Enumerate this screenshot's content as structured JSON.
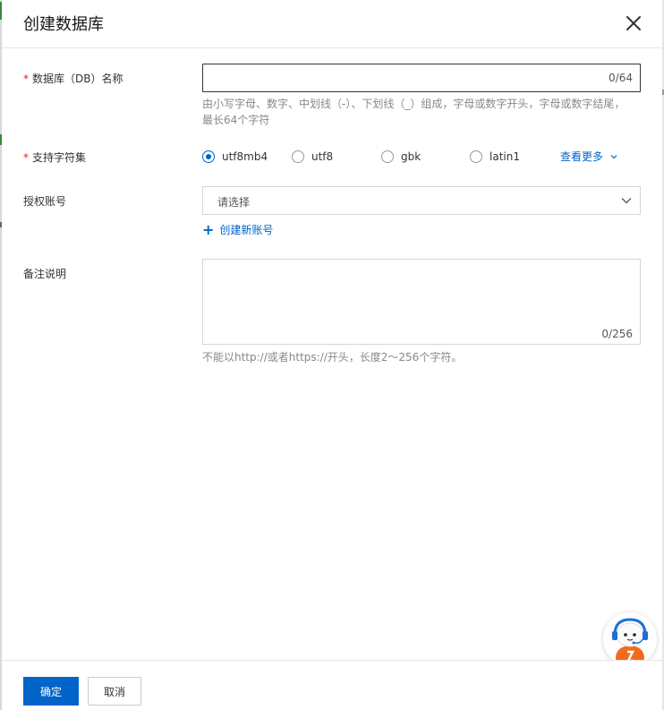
{
  "dialog": {
    "title": "创建数据库"
  },
  "form": {
    "db_name": {
      "required_mark": "*",
      "label": "数据库（DB）名称",
      "value": "",
      "counter": "0/64",
      "hint_line1": "由小写字母、数字、中划线（-）、下划线（_）组成，字母或数字开头，字母或数字结尾，",
      "hint_line2": "最长64个字符"
    },
    "charset": {
      "required_mark": "*",
      "label": "支持字符集",
      "options": [
        "utf8mb4",
        "utf8",
        "gbk",
        "latin1"
      ],
      "selected": "utf8mb4",
      "more_label": "查看更多"
    },
    "account": {
      "label": "授权账号",
      "placeholder": "请选择",
      "create_label": "创建新账号"
    },
    "remark": {
      "label": "备注说明",
      "value": "",
      "counter": "0/256",
      "hint": "不能以http://或者https://开头，长度2～256个字符。"
    }
  },
  "footer": {
    "confirm_label": "确定",
    "cancel_label": "取消"
  },
  "colors": {
    "primary": "#0064c8",
    "required": "#e02020",
    "assistant_orange": "#f26b1d"
  },
  "icons": {
    "close": "close-icon",
    "more": "chevron-down-icon",
    "select": "chevron-down-icon",
    "create": "plus-icon",
    "assistant": "assistant-avatar-icon"
  }
}
